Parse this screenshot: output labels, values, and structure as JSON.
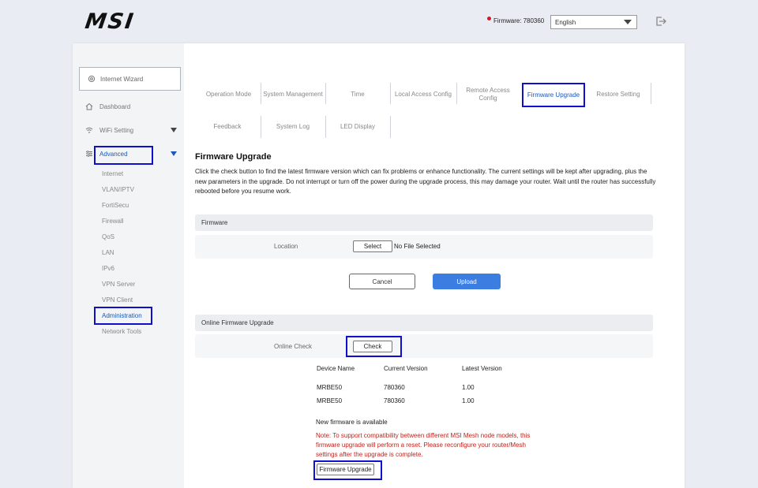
{
  "header": {
    "logo": "MSI",
    "firmware_label": "Firmware:",
    "firmware_value": "780360",
    "language": "English"
  },
  "sidebar": {
    "wizard": "Internet Wizard",
    "dashboard": "Dashboard",
    "wifi": "WiFi Setting",
    "advanced": "Advanced",
    "sub_items": [
      "Internet",
      "VLAN/IPTV",
      "FortiSecu",
      "Firewall",
      "QoS",
      "LAN",
      "IPv6",
      "VPN Server",
      "VPN Client",
      "Administration",
      "Network Tools"
    ]
  },
  "tabs": {
    "row1": [
      "Operation Mode",
      "System Management",
      "Time",
      "Local Access Config",
      "Remote Access Config",
      "Firmware Upgrade",
      "Restore Setting"
    ],
    "row2": [
      "Feedback",
      "System Log",
      "LED Display"
    ]
  },
  "page": {
    "title": "Firmware Upgrade",
    "description": "Click the check button to find the latest firmware version which can fix problems or enhance functionality. The current settings will be kept after upgrading, plus the new parameters in the upgrade. Do not interrupt or turn off the power during the upgrade process, this may damage your router. Wait until the router has successfully rebooted before you resume work."
  },
  "firmware_section": {
    "heading": "Firmware",
    "location_label": "Location",
    "select_label": "Select",
    "file_status": "No File Selected",
    "cancel_label": "Cancel",
    "upload_label": "Upload"
  },
  "online_section": {
    "heading": "Online Firmware Upgrade",
    "check_label": "Online Check",
    "check_button": "Check",
    "columns": [
      "Device Name",
      "Current Version",
      "Latest Version"
    ],
    "rows": [
      [
        "MRBE50",
        "780360",
        "1.00"
      ],
      [
        "MRBE50",
        "780360",
        "1.00"
      ]
    ],
    "status": "New firmware is available",
    "note": "Note: To support compatibility between different MSI Mesh node models, this firmware upgrade will perform a reset. Please reconfigure your router/Mesh settings after the upgrade is complete.",
    "upgrade_button": "Firmware Upgrade"
  }
}
